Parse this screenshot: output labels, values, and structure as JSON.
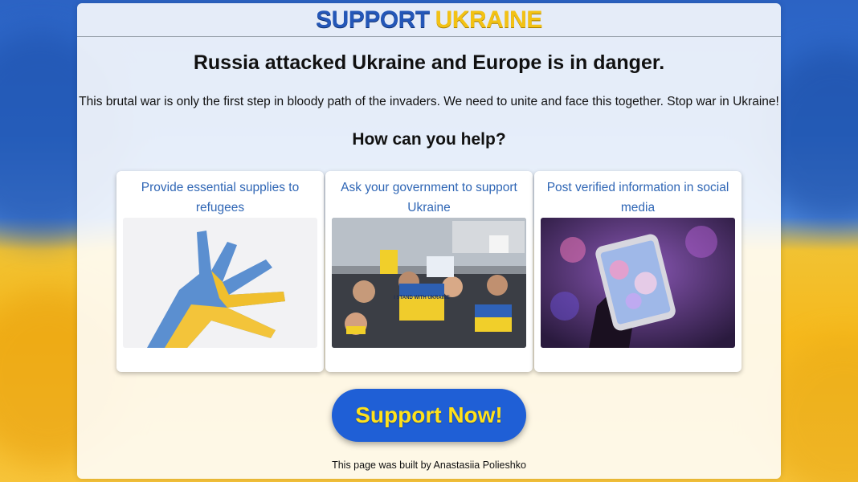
{
  "header": {
    "logo_part1": "SUPPORT",
    "logo_part2": "UKRAINE"
  },
  "main": {
    "headline": "Russia attacked Ukraine and Europe is in danger.",
    "intro": "This brutal war is only the first step in bloody path of the invaders. We need to unite and face this together. Stop war in Ukraine!",
    "subhead": "How can you help?"
  },
  "cards": [
    {
      "title": "Provide essential supplies to refugees",
      "image": "hand-painted-flag-image"
    },
    {
      "title": "Ask your government to support Ukraine",
      "image": "protest-crowd-image",
      "signs": [
        "I STAND WITH UKRAINE"
      ]
    },
    {
      "title": "Post verified information in social media",
      "image": "smartphone-image"
    }
  ],
  "cta": {
    "label": "Support Now!"
  },
  "footer": {
    "text": "This page was built by Anastasiia Polieshko"
  },
  "colors": {
    "blue": "#2457b8",
    "yellow": "#f3c214",
    "link": "#2f66b5",
    "button": "#1f5fd6",
    "button_text": "#ffe11a"
  }
}
